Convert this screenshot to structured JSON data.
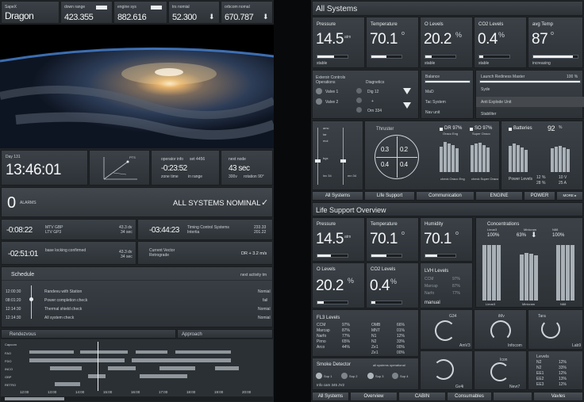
{
  "left": {
    "craft": {
      "label": "SapeX",
      "name": "Dragon"
    },
    "top_stats": [
      {
        "label": "down range",
        "value": "423.355"
      },
      {
        "label": "engine sys",
        "value": "882.616"
      },
      {
        "label": "trs nomial",
        "value": "52.300"
      },
      {
        "label": "orbcom nomal",
        "value": "670.787"
      }
    ],
    "day": "Day 131",
    "clock": "13:46:01",
    "plot_label": "PTS",
    "operator": {
      "label": "operator info",
      "set": "set 4456",
      "value": "-0:23:52",
      "zone": "zone time",
      "range": "in range"
    },
    "next_node": {
      "label": "next node",
      "value": "43 sec",
      "sub1": "300v",
      "sub2": "rotation 90°"
    },
    "alarms": {
      "count": "0",
      "label": "ALARMS",
      "status": "ALL SYSTEMS NOMINAL",
      "check": "✓"
    },
    "events": [
      {
        "time": "-0:08:22",
        "line1": "MTV GBP",
        "line2": "LTV GP3",
        "v1": "43.3 dv",
        "v2": "34 sec"
      },
      {
        "time": "-02:51:01",
        "line1": "base locking confirmed",
        "line2": "",
        "v1": "43.3 dv",
        "v2": "34 sec"
      }
    ],
    "timing": {
      "time": "-03:44:23",
      "line1": "Timing Control Systems",
      "line2": "Intertia",
      "v1": "233.33",
      "v2": "201.22"
    },
    "vector": {
      "line1": "Current Vector",
      "line2": "Retrograde",
      "value": "DR + 3.2 m/s"
    },
    "schedule": {
      "title": "Schedule",
      "right": "next activity tm",
      "items": [
        {
          "time": "12:00:30",
          "label": "Randevu with Station",
          "status": "Nomial"
        },
        {
          "time": "08:01:20",
          "label": "Power completion check",
          "status": "fail"
        },
        {
          "time": "12:14:30",
          "label": "Thermal shield check",
          "status": "Nomial"
        },
        {
          "time": "12:14:30",
          "label": "All system check",
          "status": "Nomial"
        }
      ]
    },
    "rendezvous": {
      "tab1": "Rendezvous",
      "tab2": "Approach",
      "rows": [
        "Capcom",
        "FAO",
        "FDO",
        "INCO",
        "GBP",
        "RETRO"
      ],
      "times": [
        "12:00",
        "13:00",
        "14:00",
        "15:00",
        "16:00",
        "17:00",
        "18:00",
        "19:00",
        "20:00"
      ]
    }
  },
  "right": {
    "sys_title": "All Systems",
    "sys_metrics": [
      {
        "label": "Pressure",
        "value": "14.5",
        "unit": "atm",
        "foot": "stable",
        "pct": 0.55
      },
      {
        "label": "Temperature",
        "value": "70.1",
        "unit": "o",
        "foot": "",
        "pct": 0.5
      },
      {
        "label": "O Levels",
        "value": "20.2",
        "unit": "%",
        "foot": "stable",
        "pct": 0.22
      },
      {
        "label": "CO2 Levels",
        "value": "0.4",
        "unit": "%",
        "foot": "stable",
        "pct": 0.12
      },
      {
        "label": "avg Temp",
        "value": "87",
        "unit": "o",
        "foot": "increasing",
        "pct": 0.9
      }
    ],
    "exterior": {
      "title": "Exteroir Controls",
      "ops": "Operations",
      "v1": "Valve 1",
      "v2": "Valve 2",
      "diag": "Diagnetics",
      "d1": "Dig 12",
      "d2": "+",
      "d3": "Orn 334"
    },
    "balance": {
      "title": "Balance",
      "r1": "MaD",
      "r2": "Tac System",
      "r3": "Nav unit"
    },
    "launch": {
      "title": "Launch Rediness Master",
      "pct": "100 %",
      "r1": "Syde",
      "r2": "Anti Explode Unit",
      "r3": "Stabiliter"
    },
    "thrusters": {
      "title": "Thruster",
      "q": [
        "0.3",
        "0.2",
        "0.4",
        "0.4"
      ],
      "dr": "DR 97%",
      "dr_sub": "Oraco Eng",
      "so": "SO 97%",
      "so_sub": "Super Oraco",
      "check1": "check Oraco Eng",
      "check2": "check Super Oraco"
    },
    "batteries": {
      "title": "Batteries",
      "pct": "92",
      "unit": "%",
      "pow": "Power Levels",
      "l1": "12 %",
      "l2": "28 %",
      "l3": "10 V",
      "l4": "25 A"
    },
    "gauges": {
      "labels": [
        "amc",
        "tar",
        "mol",
        "bgs",
        "lnv 34",
        "mn 34"
      ]
    },
    "tabs": [
      "All Systems",
      "Life Support",
      "Communication",
      "ENGINE",
      "POWER",
      "MORE ▸"
    ],
    "ls_title": "Life Support Overview",
    "ls_metrics": [
      {
        "label": "Pressure",
        "value": "14.5",
        "unit": "atm",
        "pct": 0.45
      },
      {
        "label": "Temperature",
        "value": "70.1",
        "unit": "o",
        "pct": 0.5
      },
      {
        "label": "Humidity",
        "value": "70.1",
        "unit": "o",
        "pct": 0.4
      }
    ],
    "concentrations": {
      "title": "Concentrations",
      "c1": "Limar3",
      "c2": "Minicram",
      "c3": "N88",
      "p1": "100%",
      "p2": "63%",
      "p3": "100%"
    },
    "ls_metrics2": [
      {
        "label": "O Levels",
        "value": "20.2",
        "unit": "%",
        "pct": 0.2
      },
      {
        "label": "CO2 Levels",
        "value": "0.4",
        "unit": "%",
        "pct": 0.12
      }
    ],
    "lvh": {
      "title": "LVH Levels",
      "rows": [
        [
          "CCM",
          "97%"
        ],
        [
          "Marcap",
          "87%"
        ],
        [
          "Narfo",
          "77%"
        ]
      ],
      "foot": "manual"
    },
    "fl3": {
      "title": "FL3 Levels",
      "col1": [
        [
          "CCM",
          "97%"
        ],
        [
          "Marcap",
          "87%"
        ],
        [
          "Narfo",
          "77%"
        ],
        [
          "Pirno",
          "65%"
        ],
        [
          "Arco",
          "44%"
        ]
      ],
      "col2": [
        [
          "OMB",
          "66%"
        ],
        [
          "MNT",
          "01%"
        ],
        [
          "N1",
          "12%"
        ],
        [
          "N2",
          "33%"
        ],
        [
          "Ze1",
          "00%"
        ],
        [
          "Ze1",
          "00%"
        ]
      ]
    },
    "smoke": {
      "title": "Smoke Detector",
      "status": "all systems operational",
      "items": [
        "Sup 1",
        "Sup 2",
        "Sup 3",
        "Sup 4"
      ],
      "info": "Info cam 345 JV2"
    },
    "dials": [
      {
        "top": "G34",
        "bottom": "AmV3"
      },
      {
        "top": "iMv",
        "bottom": "Infocom"
      },
      {
        "top": "Tara",
        "bottom": "Lab9"
      },
      {
        "top": "",
        "bottom": "Gv4i"
      },
      {
        "top": "Icon",
        "bottom": "Nevr7"
      }
    ],
    "levels": {
      "title": "Levels",
      "rows": [
        [
          "N2",
          "12%"
        ],
        [
          "N2",
          "33%"
        ],
        [
          "EE1",
          "12%"
        ],
        [
          "EE2",
          "13%"
        ],
        [
          "EE3",
          "12%"
        ]
      ]
    },
    "bottom_tabs": [
      "All Systems",
      "Overview",
      "CABIN",
      "Consumables",
      "Vavles"
    ]
  }
}
